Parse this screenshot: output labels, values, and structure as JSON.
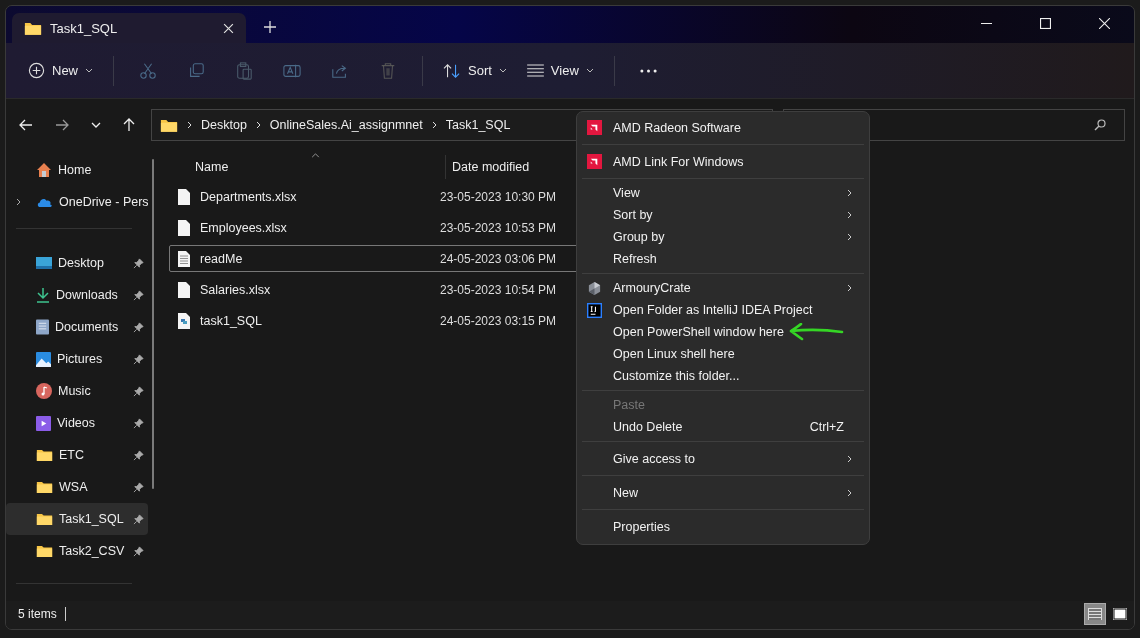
{
  "window": {
    "tab": {
      "title": "Task1_SQL",
      "selected": true
    }
  },
  "toolbar": {
    "new": "New",
    "sort": "Sort",
    "view": "View"
  },
  "address": {
    "crumbs": [
      "Desktop",
      "OnlineSales.Ai_assignmnet",
      "Task1_SQL"
    ]
  },
  "sidebar": {
    "top": [
      {
        "label": "Home",
        "kind": "home",
        "expandable": false
      },
      {
        "label": "OneDrive - Pers",
        "kind": "cloud",
        "expandable": true
      }
    ],
    "pinned": [
      {
        "label": "Desktop",
        "kind": "desktop",
        "selected": false
      },
      {
        "label": "Downloads",
        "kind": "download",
        "selected": false
      },
      {
        "label": "Documents",
        "kind": "documents",
        "selected": false
      },
      {
        "label": "Pictures",
        "kind": "pictures",
        "selected": false
      },
      {
        "label": "Music",
        "kind": "music",
        "selected": false
      },
      {
        "label": "Videos",
        "kind": "videos",
        "selected": false
      },
      {
        "label": "ETC",
        "kind": "folder",
        "selected": false
      },
      {
        "label": "WSA",
        "kind": "folder",
        "selected": false
      },
      {
        "label": "Task1_SQL",
        "kind": "folder",
        "selected": true
      },
      {
        "label": "Task2_CSV",
        "kind": "folder",
        "selected": false
      }
    ]
  },
  "files": {
    "columns": [
      "Name",
      "Date modified"
    ],
    "rows": [
      {
        "name": "Departments.xlsx",
        "date": "23-05-2023 10:30 PM",
        "kind": "blank",
        "focused": false
      },
      {
        "name": "Employees.xlsx",
        "date": "23-05-2023 10:53 PM",
        "kind": "blank",
        "focused": false
      },
      {
        "name": "readMe",
        "date": "24-05-2023 03:06 PM",
        "kind": "text",
        "focused": true
      },
      {
        "name": "Salaries.xlsx",
        "date": "23-05-2023 10:54 PM",
        "kind": "blank",
        "focused": false
      },
      {
        "name": "task1_SQL",
        "date": "24-05-2023 03:15 PM",
        "kind": "python",
        "focused": false
      }
    ]
  },
  "context_menu": [
    [
      {
        "label": "AMD Radeon Software",
        "kind": "amd",
        "submenu": false,
        "disabled": false
      }
    ],
    [
      {
        "label": "AMD Link For Windows",
        "kind": "amd",
        "submenu": false,
        "disabled": false
      }
    ],
    [
      {
        "label": "View",
        "submenu": true,
        "disabled": false
      },
      {
        "label": "Sort by",
        "submenu": true,
        "disabled": false
      },
      {
        "label": "Group by",
        "submenu": true,
        "disabled": false
      },
      {
        "label": "Refresh",
        "submenu": false,
        "disabled": false
      }
    ],
    [
      {
        "label": "ArmouryCrate",
        "kind": "armoury",
        "submenu": true,
        "disabled": false
      },
      {
        "label": "Open Folder as IntelliJ IDEA Project",
        "kind": "intellij",
        "submenu": false,
        "disabled": false
      },
      {
        "label": "Open PowerShell window here",
        "submenu": false,
        "disabled": false,
        "annotated": true
      },
      {
        "label": "Open Linux shell here",
        "submenu": false,
        "disabled": false
      },
      {
        "label": "Customize this folder...",
        "submenu": false,
        "disabled": false
      }
    ],
    [
      {
        "label": "Paste",
        "submenu": false,
        "disabled": true
      },
      {
        "label": "Undo Delete",
        "shortcut": "Ctrl+Z",
        "submenu": false,
        "disabled": false
      }
    ],
    [
      {
        "label": "Give access to",
        "submenu": true,
        "disabled": false
      }
    ],
    [
      {
        "label": "New",
        "submenu": true,
        "disabled": false
      }
    ],
    [
      {
        "label": "Properties",
        "submenu": false,
        "disabled": false
      }
    ]
  ],
  "status_bar": {
    "count": "5 items",
    "views": [
      {
        "kind": "details",
        "selected": true
      },
      {
        "kind": "tiles",
        "selected": false
      }
    ]
  }
}
